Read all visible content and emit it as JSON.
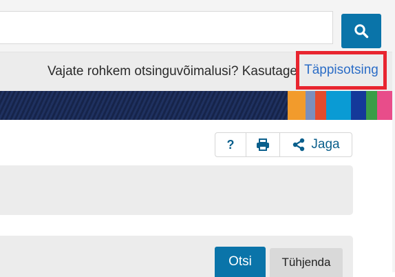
{
  "search": {
    "value": "",
    "placeholder": "",
    "button_icon": "search-icon"
  },
  "advanced": {
    "prompt": "Vajate rohkem otsinguvõimalusi? Kasutage",
    "link_label": "Täppisotsing",
    "highlight_color": "#e8252f"
  },
  "banner": {
    "stripe_colors": [
      "#f29b2c",
      "#7b8fbd",
      "#e54b2c",
      "#0a9bd4",
      "#14399a",
      "#3a9d47",
      "#e84d8a"
    ]
  },
  "toolbar": {
    "help_label": "?",
    "print_icon": "print-icon",
    "share_icon": "share-icon",
    "share_label": "Jaga"
  },
  "form": {
    "submit_label": "Otsi",
    "clear_label": "Tühjenda"
  },
  "colors": {
    "primary": "#0a74a9",
    "link": "#2a6cc6"
  }
}
